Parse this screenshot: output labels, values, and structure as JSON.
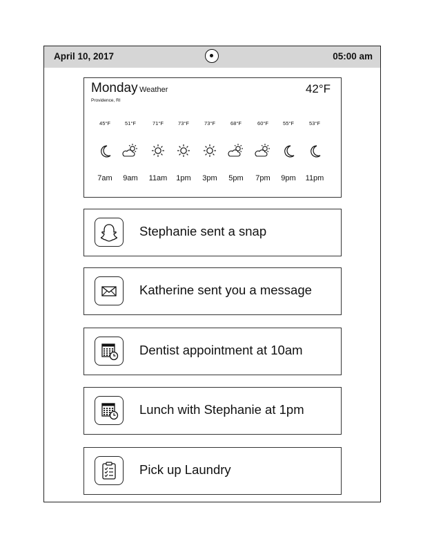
{
  "status_bar": {
    "date": "April 10, 2017",
    "time": "05:00 am"
  },
  "weather": {
    "day": "Monday",
    "label": "Weather",
    "location": "Providence, RI",
    "current_temp": "42°F",
    "hours": [
      {
        "temp": "45°F",
        "icon": "moon-icon",
        "time": "7am"
      },
      {
        "temp": "51°F",
        "icon": "partly-cloudy-icon",
        "time": "9am"
      },
      {
        "temp": "71°F",
        "icon": "sun-icon",
        "time": "11am"
      },
      {
        "temp": "73°F",
        "icon": "sun-icon",
        "time": "1pm"
      },
      {
        "temp": "73°F",
        "icon": "sun-icon",
        "time": "3pm"
      },
      {
        "temp": "68°F",
        "icon": "partly-cloudy-icon",
        "time": "5pm"
      },
      {
        "temp": "60°F",
        "icon": "partly-cloudy-icon",
        "time": "7pm"
      },
      {
        "temp": "55°F",
        "icon": "moon-icon",
        "time": "9pm"
      },
      {
        "temp": "53°F",
        "icon": "moon-icon",
        "time": "11pm"
      }
    ]
  },
  "notifications": [
    {
      "icon": "snapchat-ghost-icon",
      "text": "Stephanie sent a snap"
    },
    {
      "icon": "envelope-icon",
      "text": "Katherine sent you a message"
    },
    {
      "icon": "calendar-clock-icon",
      "text": "Dentist appointment at 10am"
    },
    {
      "icon": "calendar-clock-icon",
      "text": "Lunch with Stephanie at 1pm"
    },
    {
      "icon": "clipboard-checklist-icon",
      "text": "Pick up Laundry"
    }
  ]
}
